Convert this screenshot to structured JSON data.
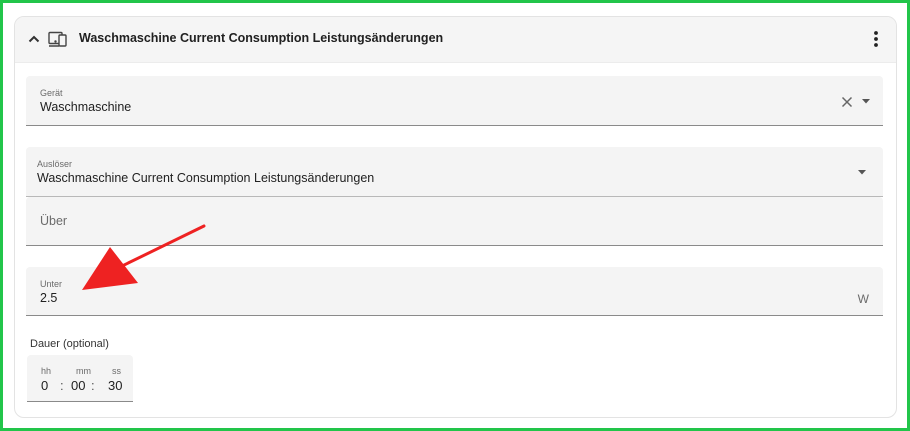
{
  "header": {
    "title": "Waschmaschine Current Consumption Leistungsänderungen",
    "collapse_icon": "chevron-up-icon",
    "device_icon": "devices-icon",
    "menu_icon": "kebab-menu-icon"
  },
  "device_field": {
    "label": "Gerät",
    "value": "Waschmaschine",
    "clear_icon": "close-icon",
    "dropdown_icon": "caret-down-icon"
  },
  "trigger_field": {
    "label": "Auslöser",
    "value": "Waschmaschine Current Consumption Leistungsänderungen",
    "dropdown_icon": "caret-down-icon"
  },
  "above_field": {
    "placeholder": "Über"
  },
  "below_field": {
    "label": "Unter",
    "value": "2.5",
    "unit": "W"
  },
  "duration": {
    "label": "Dauer (optional)",
    "hh_label": "hh",
    "mm_label": "mm",
    "ss_label": "ss",
    "hh": "0",
    "mm": "00",
    "ss": "30",
    "separator": ":"
  },
  "colors": {
    "frame_border": "#22c54a",
    "annotation_arrow": "#ee2222",
    "field_background": "#f4f4f4"
  }
}
